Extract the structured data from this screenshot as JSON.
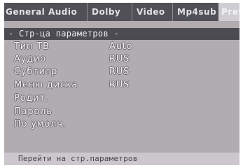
{
  "tabs": [
    {
      "label": "General Audio"
    },
    {
      "label": "Dolby"
    },
    {
      "label": "Video"
    },
    {
      "label": "Mp4sub"
    },
    {
      "label": "Pref"
    }
  ],
  "menu": {
    "header": "- Стр-ца параметров -",
    "items": [
      {
        "label": "Тип ТВ",
        "value": "Auto"
      },
      {
        "label": "Аудио",
        "value": "RUS"
      },
      {
        "label": "Субтитр",
        "value": "RUS"
      },
      {
        "label": "Меню диска",
        "value": "RUS"
      },
      {
        "label": "Родит."
      },
      {
        "label": "Пароль"
      },
      {
        "label": "По умолч."
      }
    ]
  },
  "status": {
    "text": "Перейти на стр.параметров"
  }
}
